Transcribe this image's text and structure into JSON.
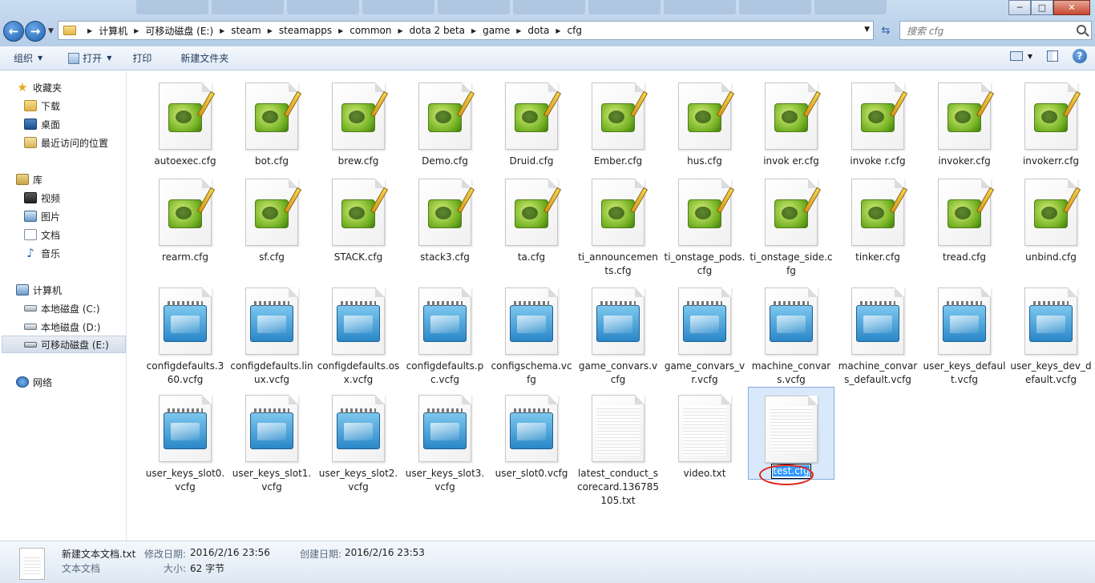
{
  "address": {
    "crumbs": [
      "计算机",
      "可移动磁盘 (E:)",
      "steam",
      "steamapps",
      "common",
      "dota 2 beta",
      "game",
      "dota",
      "cfg"
    ]
  },
  "search": {
    "placeholder": "搜索 cfg"
  },
  "toolbar": {
    "organize": "组织",
    "open": "打开",
    "print": "打印",
    "new_folder": "新建文件夹"
  },
  "sidebar": {
    "favorites": "收藏夹",
    "downloads": "下载",
    "desktop": "桌面",
    "recent": "最近访问的位置",
    "libraries": "库",
    "videos": "视频",
    "pictures": "图片",
    "documents": "文档",
    "music": "音乐",
    "computer": "计算机",
    "drive_c": "本地磁盘 (C:)",
    "drive_d": "本地磁盘 (D:)",
    "drive_e": "可移动磁盘 (E:)",
    "network": "网络"
  },
  "files": [
    {
      "name": "autoexec.cfg",
      "icon": "notepad-plus-plus-icon"
    },
    {
      "name": "bot.cfg",
      "icon": "notepad-plus-plus-icon"
    },
    {
      "name": "brew.cfg",
      "icon": "notepad-plus-plus-icon"
    },
    {
      "name": "Demo.cfg",
      "icon": "notepad-plus-plus-icon"
    },
    {
      "name": "Druid.cfg",
      "icon": "notepad-plus-plus-icon"
    },
    {
      "name": "Ember.cfg",
      "icon": "notepad-plus-plus-icon"
    },
    {
      "name": "hus.cfg",
      "icon": "notepad-plus-plus-icon"
    },
    {
      "name": "invok er.cfg",
      "icon": "notepad-plus-plus-icon"
    },
    {
      "name": "invoke r.cfg",
      "icon": "notepad-plus-plus-icon"
    },
    {
      "name": "invoker.cfg",
      "icon": "notepad-plus-plus-icon"
    },
    {
      "name": "invokerr.cfg",
      "icon": "notepad-plus-plus-icon"
    },
    {
      "name": "rearm.cfg",
      "icon": "notepad-plus-plus-icon"
    },
    {
      "name": "sf.cfg",
      "icon": "notepad-plus-plus-icon"
    },
    {
      "name": "STACK.cfg",
      "icon": "notepad-plus-plus-icon"
    },
    {
      "name": "stack3.cfg",
      "icon": "notepad-plus-plus-icon"
    },
    {
      "name": "ta.cfg",
      "icon": "notepad-plus-plus-icon"
    },
    {
      "name": "ti_announcements.cfg",
      "icon": "notepad-plus-plus-icon"
    },
    {
      "name": "ti_onstage_pods.cfg",
      "icon": "notepad-plus-plus-icon"
    },
    {
      "name": "ti_onstage_side.cfg",
      "icon": "notepad-plus-plus-icon"
    },
    {
      "name": "tinker.cfg",
      "icon": "notepad-plus-plus-icon"
    },
    {
      "name": "tread.cfg",
      "icon": "notepad-plus-plus-icon"
    },
    {
      "name": "unbind.cfg",
      "icon": "notepad-plus-plus-icon"
    },
    {
      "name": "configdefaults.360.vcfg",
      "icon": "notepad-icon"
    },
    {
      "name": "configdefaults.linux.vcfg",
      "icon": "notepad-icon"
    },
    {
      "name": "configdefaults.osx.vcfg",
      "icon": "notepad-icon"
    },
    {
      "name": "configdefaults.pc.vcfg",
      "icon": "notepad-icon"
    },
    {
      "name": "configschema.vcfg",
      "icon": "notepad-icon"
    },
    {
      "name": "game_convars.vcfg",
      "icon": "notepad-icon"
    },
    {
      "name": "game_convars_vr.vcfg",
      "icon": "notepad-icon"
    },
    {
      "name": "machine_convars.vcfg",
      "icon": "notepad-icon"
    },
    {
      "name": "machine_convars_default.vcfg",
      "icon": "notepad-icon"
    },
    {
      "name": "user_keys_default.vcfg",
      "icon": "notepad-icon"
    },
    {
      "name": "user_keys_dev_default.vcfg",
      "icon": "notepad-icon"
    },
    {
      "name": "user_keys_slot0.vcfg",
      "icon": "notepad-icon"
    },
    {
      "name": "user_keys_slot1.vcfg",
      "icon": "notepad-icon"
    },
    {
      "name": "user_keys_slot2.vcfg",
      "icon": "notepad-icon"
    },
    {
      "name": "user_keys_slot3.vcfg",
      "icon": "notepad-icon"
    },
    {
      "name": "user_slot0.vcfg",
      "icon": "notepad-icon"
    },
    {
      "name": "latest_conduct_scorecard.136785105.txt",
      "icon": "text-document-icon"
    },
    {
      "name": "video.txt",
      "icon": "text-document-icon"
    },
    {
      "name": "test.cfg",
      "icon": "text-document-icon",
      "selected": true,
      "renaming": true
    }
  ],
  "details": {
    "filename": "新建文本文档.txt",
    "type": "文本文档",
    "modified_label": "修改日期:",
    "modified_value": "2016/2/16 23:56",
    "created_label": "创建日期:",
    "created_value": "2016/2/16 23:53",
    "size_label": "大小:",
    "size_value": "62 字节"
  }
}
